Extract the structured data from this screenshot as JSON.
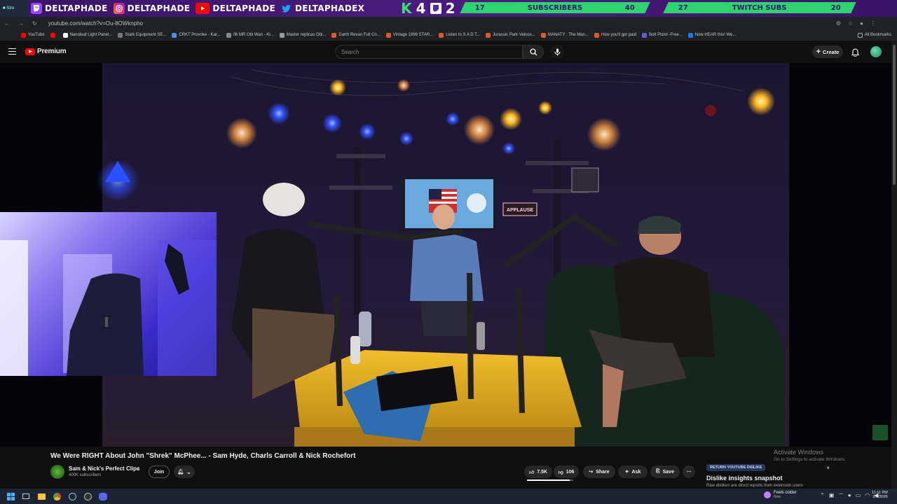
{
  "overlay": {
    "socials": [
      {
        "icon": "twitch-icon",
        "label": "DELTAPHADE",
        "color": "#9146ff"
      },
      {
        "icon": "instagram-icon",
        "label": "DELTAPHADE",
        "color": "#e1306c"
      },
      {
        "icon": "youtube-icon",
        "label": "DELTAPHADE",
        "color": "#ff0000"
      },
      {
        "icon": "twitter-icon",
        "label": "DELTAPHADEX",
        "color": "#1da1f2"
      }
    ],
    "k_text": "K",
    "k_num": "4",
    "subs_num": "2",
    "goal1": {
      "current": "17",
      "label": "SUBSCRIBERS",
      "target": "40"
    },
    "goal2": {
      "current": "27",
      "label": "TWITCH SUBS",
      "target": "20"
    },
    "accent": "#2dd36f"
  },
  "browser": {
    "url": "youtube.com/watch?v=Ou-8OWknpho",
    "bookmarks": [
      "YouTube",
      "",
      "Nanoleaf Light Panel...",
      "Stark Equipment SE...",
      "CRKT Provoke - Kar...",
      "06 MR Obi Wan - Ki...",
      "Master replicas Obi...",
      "Darth Revan Full Co...",
      "Vintage 1999 STAR...",
      "Listen to S A D T...",
      "Jurassic Park Veloce...",
      "MANATY : The Man...",
      "How you'll get paid",
      "Bolt Pistol -Free...",
      "Now HEAR this! We..."
    ],
    "all_bookmarks": "All Bookmarks"
  },
  "youtube": {
    "logo_text": "Premium",
    "search_placeholder": "Search",
    "create_label": "Create",
    "video": {
      "sign_text": "APPLAUSE",
      "title": "We Were RIGHT About John \"Shrek\" McPhee... - Sam Hyde, Charls Carroll & Nick Rochefort"
    },
    "channel": {
      "name": "Sam & Nick's Perfect Clips",
      "subscribers": "400K subscribers"
    },
    "join_label": "Join",
    "likes": "7.5K",
    "dislikes": "106",
    "share_label": "Share",
    "ask_label": "Ask",
    "save_label": "Save",
    "rydpopup": {
      "tag": "RETURN YOUTUBE DISLIKE",
      "title": "Dislike insights snapshot",
      "body": "Raw dislikes are direct reports from extension users"
    }
  },
  "windows": {
    "activate_title": "Activate Windows",
    "activate_sub": "Go to Settings to activate Windows.",
    "weather_title": "Feels colder",
    "weather_sub": "Now",
    "time": "11:11 PM",
    "date": "2/5/2026"
  }
}
